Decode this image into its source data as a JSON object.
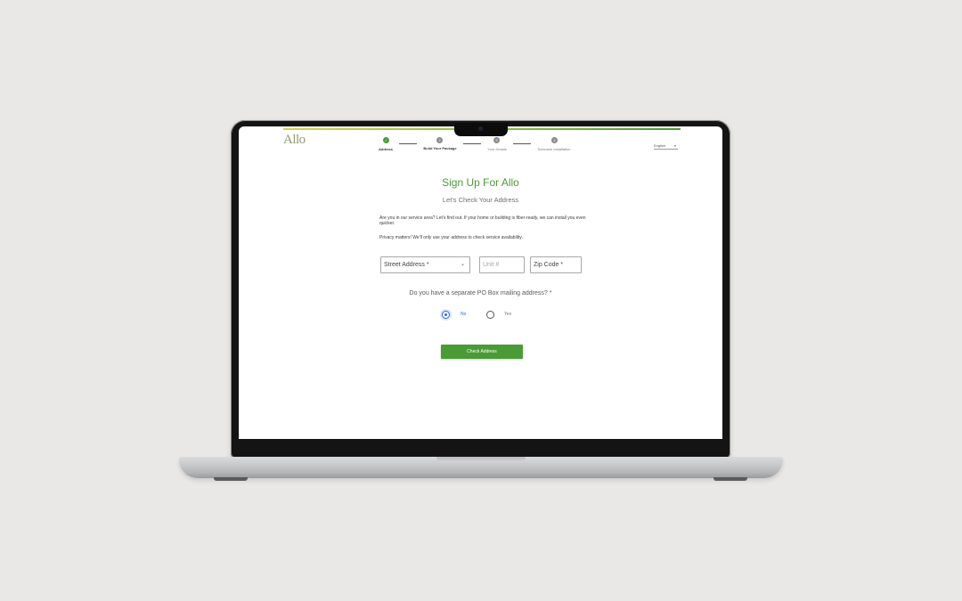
{
  "brand": {
    "logo_text": "Allo",
    "accent_color": "#4a9b36"
  },
  "stepper": {
    "steps": [
      {
        "number": "✓",
        "label": "Address",
        "state": "complete"
      },
      {
        "number": "2",
        "label": "Build Your Package",
        "state": "current"
      },
      {
        "number": "3",
        "label": "Your Details",
        "state": "upcoming"
      },
      {
        "number": "4",
        "label": "Schedule Installation",
        "state": "upcoming"
      }
    ]
  },
  "language": {
    "selected": "English",
    "icon": "chevron-down-icon"
  },
  "page": {
    "title": "Sign Up For Allo",
    "subtitle": "Let's Check Your Address",
    "intro": "Are you in our service area? Let's find out. If your home or building is fiber-ready, we can install you even quicker.",
    "privacy": "Privacy matters! We'll only use your address to check service availability."
  },
  "form": {
    "street_placeholder": "Street Address *",
    "unit_placeholder": "Unit #",
    "zip_placeholder": "Zip Code *",
    "po_box_question": "Do you have a separate PO Box mailing address? *",
    "options": [
      {
        "label": "No",
        "selected": true
      },
      {
        "label": "Yes",
        "selected": false
      }
    ],
    "submit_label": "Check Address"
  }
}
